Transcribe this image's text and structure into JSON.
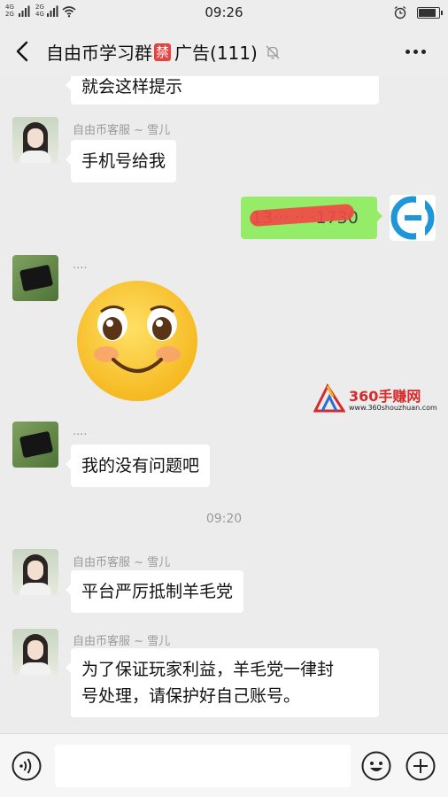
{
  "status_bar": {
    "network_top": "4G",
    "network_bottom": "2G",
    "network_top2": "2G",
    "network_bottom2": "4G",
    "time": "09:26"
  },
  "nav": {
    "title_pre": "自由币学习群",
    "ban_badge": "禁",
    "title_post": "广告(111)"
  },
  "messages": {
    "m0_partial": "就会这样提示",
    "m1_sender": "自由币客服 ~ 雪儿",
    "m1_text": "手机号给我",
    "m2_self_text": "13··· ·· ·1730",
    "m3_sender": "....",
    "m4_sender": "....",
    "m4_text": "我的没有问题吧",
    "timestamp": "09:20",
    "m5_sender": "自由币客服 ~ 雪儿",
    "m5_text": "平台严厉抵制羊毛党",
    "m6_sender": "自由币客服 ~ 雪儿",
    "m6_line1": "为了保证玩家利益，羊毛党一律封",
    "m6_line2": "号处理，请保护好自己账号。"
  },
  "watermark": {
    "brand": "360手赚网",
    "url": "www.360shouzhuan.com"
  },
  "input": {
    "placeholder": ""
  },
  "colors": {
    "self_bubble": "#95ec69",
    "ban_badge": "#e64340",
    "chat_bg": "#ececec"
  },
  "icons": [
    "back-arrow-icon",
    "mute-bell-icon",
    "more-dots-icon",
    "voice-icon",
    "emoji-icon",
    "plus-icon",
    "smiley-sticker"
  ]
}
